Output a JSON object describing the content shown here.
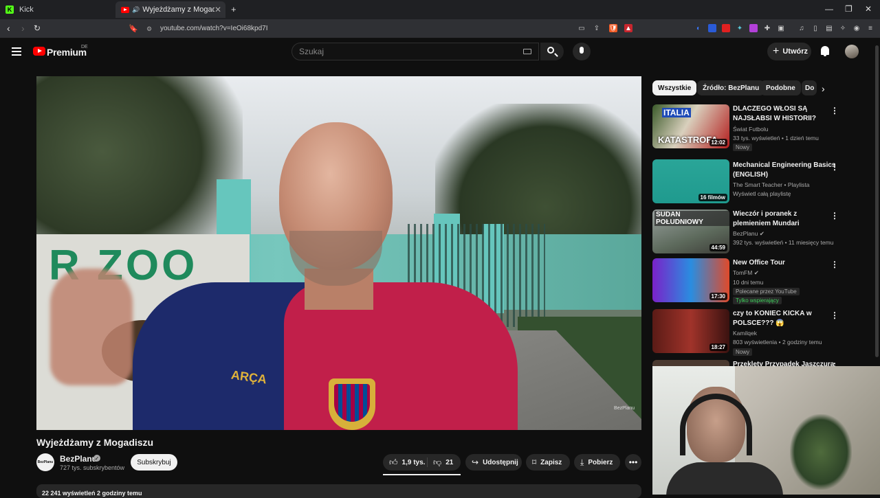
{
  "browser": {
    "tabs": [
      {
        "label": "Kick",
        "icon": "kick-icon"
      },
      {
        "label": "Wyjeżdżamy z Mogadiszu - Y",
        "icon": "youtube-icon"
      }
    ],
    "url": "youtube.com/watch?v=IeOi68kpd7I"
  },
  "header": {
    "brand": "Premium",
    "region": "DE",
    "search_placeholder": "Szukaj",
    "create_label": "Utwórz"
  },
  "video": {
    "title": "Wyjeżdżamy z Mogadiszu",
    "watermark": "BezPlanu",
    "sign_text": "R ZOO",
    "jersey_text": "ARÇA",
    "channel": {
      "name": "BezPlanu",
      "avatar_text": "BezPlanu",
      "subscribers": "727 tys. subskrybentów",
      "subscribe_label": "Subskrybuj"
    },
    "actions": {
      "likes": "1,9 tys.",
      "dislikes": "21",
      "share": "Udostępnij",
      "save": "Zapisz",
      "download": "Pobierz"
    },
    "description_stats": "22 241 wyświetleń  2 godziny temu"
  },
  "chips": [
    "Wszystkie",
    "Źródło: BezPlanu",
    "Podobne",
    "Do"
  ],
  "recommendations": [
    {
      "title": "DLACZEGO WŁOSI SĄ NAJSŁABSI W HISTORII?",
      "channel": "Świat Futbolu",
      "meta": "33 tys. wyświetleń • 1 dzień temu",
      "badge": "Nowy",
      "duration": "12:02",
      "thumb_text": "KATASTROFA",
      "thumb_text2": "ITALIA"
    },
    {
      "title": "Mechanical Engineering Basics (ENGLISH)",
      "channel": "The Smart Teacher • Playlista",
      "meta": "Wyświetl całą playlistę",
      "badge": "",
      "duration": "16 filmów",
      "thumb_text": "",
      "thumb_text2": ""
    },
    {
      "title": "Wieczór i poranek z plemieniem Mundari",
      "channel": "BezPlanu",
      "meta": "392 tys. wyświetleń • 11 miesięcy temu",
      "badge": "",
      "duration": "44:59",
      "thumb_text": "SUDAN POŁUDNIOWY",
      "thumb_text2": ""
    },
    {
      "title": "New Office Tour",
      "channel": "TomFM",
      "meta": "10 dni temu",
      "badge": "Polecane przez YouTube",
      "badge2": "Tylko wspierający",
      "duration": "17:30",
      "thumb_text": "",
      "thumb_text2": ""
    },
    {
      "title": "czy to KONIEC KICKA w POLSCE??? 😱",
      "channel": "Kamilqek",
      "meta": "803 wyświetlenia • 2 godziny temu",
      "badge": "Nowy",
      "duration": "18:27",
      "thumb_text": "",
      "thumb_text2": ""
    },
    {
      "title": "Przeklęty Przypadek Jaszczura",
      "channel": "",
      "meta": "",
      "badge": "",
      "duration": "",
      "thumb_text": "",
      "thumb_text2": ""
    }
  ],
  "colors": {
    "yt_red": "#ff0000",
    "bg": "#0f0f0f",
    "kick_green": "#53fc18"
  }
}
